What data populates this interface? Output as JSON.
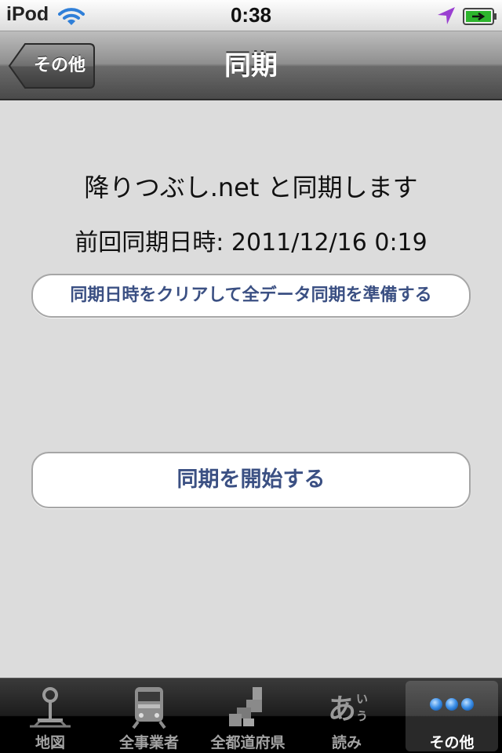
{
  "status_bar": {
    "device": "iPod",
    "time": "0:38"
  },
  "nav_bar": {
    "back_label": "その他",
    "title": "同期"
  },
  "content": {
    "sync_message": "降りつぶし.net と同期します",
    "last_sync": "前回同期日時: 2011/12/16 0:19",
    "clear_button_label": "同期日時をクリアして全データ同期を準備する",
    "start_button_label": "同期を開始する"
  },
  "tab_bar": {
    "tabs": [
      {
        "label": "地図",
        "icon": "railway-signal-icon"
      },
      {
        "label": "全事業者",
        "icon": "train-icon"
      },
      {
        "label": "全都道府県",
        "icon": "prefecture-blocks-icon"
      },
      {
        "label": "読み",
        "icon": "hiragana-reading-icon"
      },
      {
        "label": "その他",
        "icon": "more-dots-icon"
      }
    ],
    "selected": "その他"
  },
  "colors": {
    "button_text": "#3b5083",
    "content_background": "#dcdcdc",
    "wifi_blue": "#2f7fd8",
    "location_purple": "#9a3fd1",
    "battery_green": "#2db52d",
    "more_dots_blue": "#3c8fe8"
  }
}
